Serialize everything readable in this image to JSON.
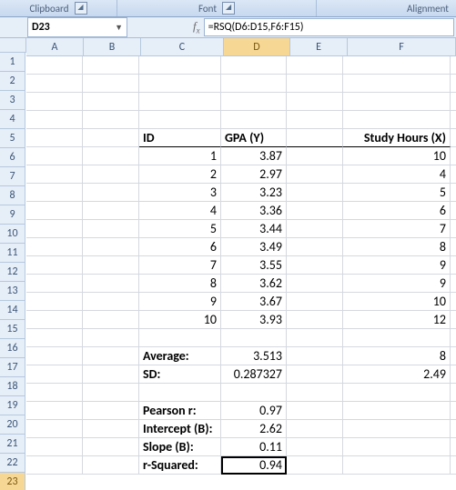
{
  "ribbon": {
    "groups": [
      "Clipboard",
      "Font",
      "Alignment"
    ]
  },
  "namebox": "D23",
  "formula": "=RSQ(D6:D15,F6:F15)",
  "columns": [
    "A",
    "B",
    "C",
    "D",
    "E",
    "F"
  ],
  "rows": [
    "1",
    "2",
    "3",
    "4",
    "5",
    "6",
    "7",
    "8",
    "9",
    "10",
    "11",
    "12",
    "13",
    "14",
    "15",
    "16",
    "17",
    "18",
    "19",
    "20",
    "21",
    "22",
    "23"
  ],
  "active": {
    "col": "D",
    "row": "23"
  },
  "headers": {
    "c5": "ID",
    "d5": "GPA (Y)",
    "f5": "Study Hours (X)"
  },
  "data_rows": [
    {
      "id": "1",
      "gpa": "3.87",
      "hrs": "10"
    },
    {
      "id": "2",
      "gpa": "2.97",
      "hrs": "4"
    },
    {
      "id": "3",
      "gpa": "3.23",
      "hrs": "5"
    },
    {
      "id": "4",
      "gpa": "3.36",
      "hrs": "6"
    },
    {
      "id": "5",
      "gpa": "3.44",
      "hrs": "7"
    },
    {
      "id": "6",
      "gpa": "3.49",
      "hrs": "8"
    },
    {
      "id": "7",
      "gpa": "3.55",
      "hrs": "9"
    },
    {
      "id": "8",
      "gpa": "3.62",
      "hrs": "9"
    },
    {
      "id": "9",
      "gpa": "3.67",
      "hrs": "10"
    },
    {
      "id": "10",
      "gpa": "3.93",
      "hrs": "12"
    }
  ],
  "stats": {
    "avg_label": "Average:",
    "avg_gpa": "3.513",
    "avg_hrs": "8",
    "sd_label": "SD:",
    "sd_gpa": "0.287327",
    "sd_hrs": "2.49",
    "r_label": "Pearson r:",
    "r_val": "0.97",
    "intB_label": "Intercept (B):",
    "intB_val": "2.62",
    "slopeB_label": "Slope (B):",
    "slopeB_val": "0.11",
    "r2_label": "r-Squared:",
    "r2_val": "0.94"
  },
  "chart_data": {
    "type": "table",
    "title": "GPA vs Study Hours regression",
    "columns": [
      "ID",
      "GPA (Y)",
      "Study Hours (X)"
    ],
    "rows": [
      [
        1,
        3.87,
        10
      ],
      [
        2,
        2.97,
        4
      ],
      [
        3,
        3.23,
        5
      ],
      [
        4,
        3.36,
        6
      ],
      [
        5,
        3.44,
        7
      ],
      [
        6,
        3.49,
        8
      ],
      [
        7,
        3.55,
        9
      ],
      [
        8,
        3.62,
        9
      ],
      [
        9,
        3.67,
        10
      ],
      [
        10,
        3.93,
        12
      ]
    ],
    "summary": {
      "average": {
        "gpa": 3.513,
        "hours": 8
      },
      "sd": {
        "gpa": 0.287327,
        "hours": 2.49
      },
      "pearson_r": 0.97,
      "intercept": 2.62,
      "slope": 0.11,
      "r_squared": 0.94
    }
  }
}
